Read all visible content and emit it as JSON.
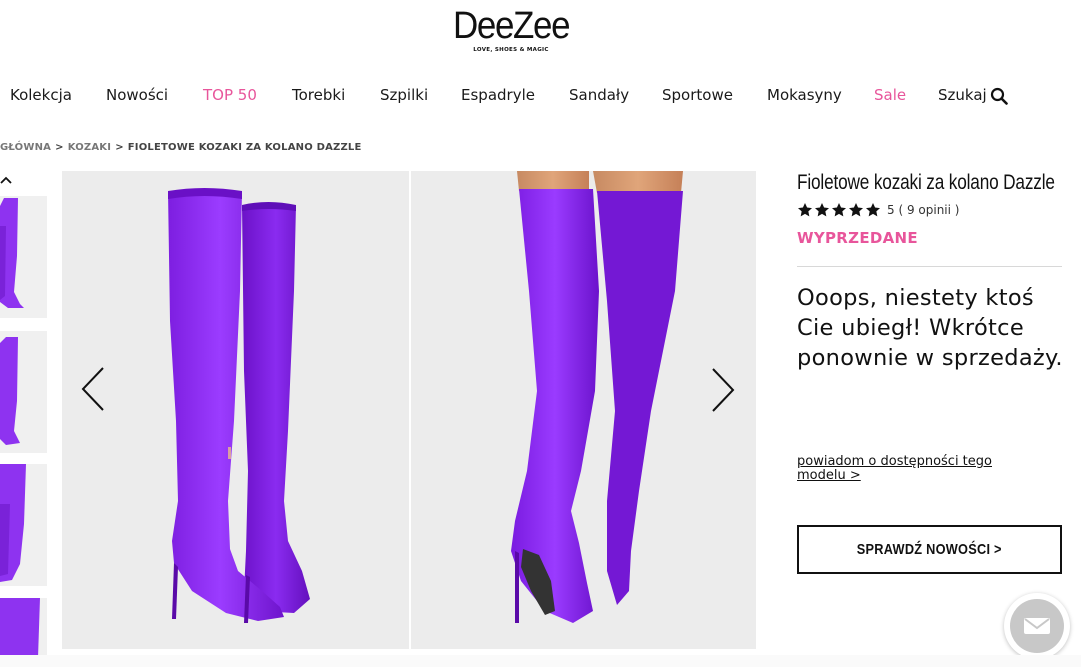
{
  "brand": {
    "name": "DeeZee",
    "tagline": "LOVE, SHOES & MAGIC"
  },
  "nav": {
    "items": [
      {
        "label": "Kolekcja",
        "highlight": false
      },
      {
        "label": "Nowości",
        "highlight": false
      },
      {
        "label": "TOP 50",
        "highlight": true
      },
      {
        "label": "Torebki",
        "highlight": false
      },
      {
        "label": "Szpilki",
        "highlight": false
      },
      {
        "label": "Espadryle",
        "highlight": false
      },
      {
        "label": "Sandały",
        "highlight": false
      },
      {
        "label": "Sportowe",
        "highlight": false
      },
      {
        "label": "Mokasyny",
        "highlight": false
      },
      {
        "label": "Sale",
        "highlight": true
      },
      {
        "label": "Szukaj",
        "highlight": false
      }
    ],
    "search_icon": "search-icon"
  },
  "breadcrumb": {
    "items": [
      "GŁÓWNA",
      "KOZAKI",
      "FIOLETOWE KOZAKI ZA KOLANO DAZZLE"
    ],
    "separator": ">"
  },
  "product": {
    "title": "Fioletowe kozaki za kolano Dazzle",
    "rating": 5,
    "rating_text": "5 ( 9 opinii )",
    "status": "WYPRZEDANE",
    "sold_out_message": "Ooops, niestety ktoś Cie ubiegł! Wkrótce ponownie w sprzedaży.",
    "notify_link": "powiadom o dostępności tego modelu >",
    "cta_label": "SPRAWDŹ NOWOŚCI >"
  },
  "colors": {
    "accent_pink": "#e8559b",
    "product_purple": "#8a2be2",
    "text": "#111111"
  }
}
